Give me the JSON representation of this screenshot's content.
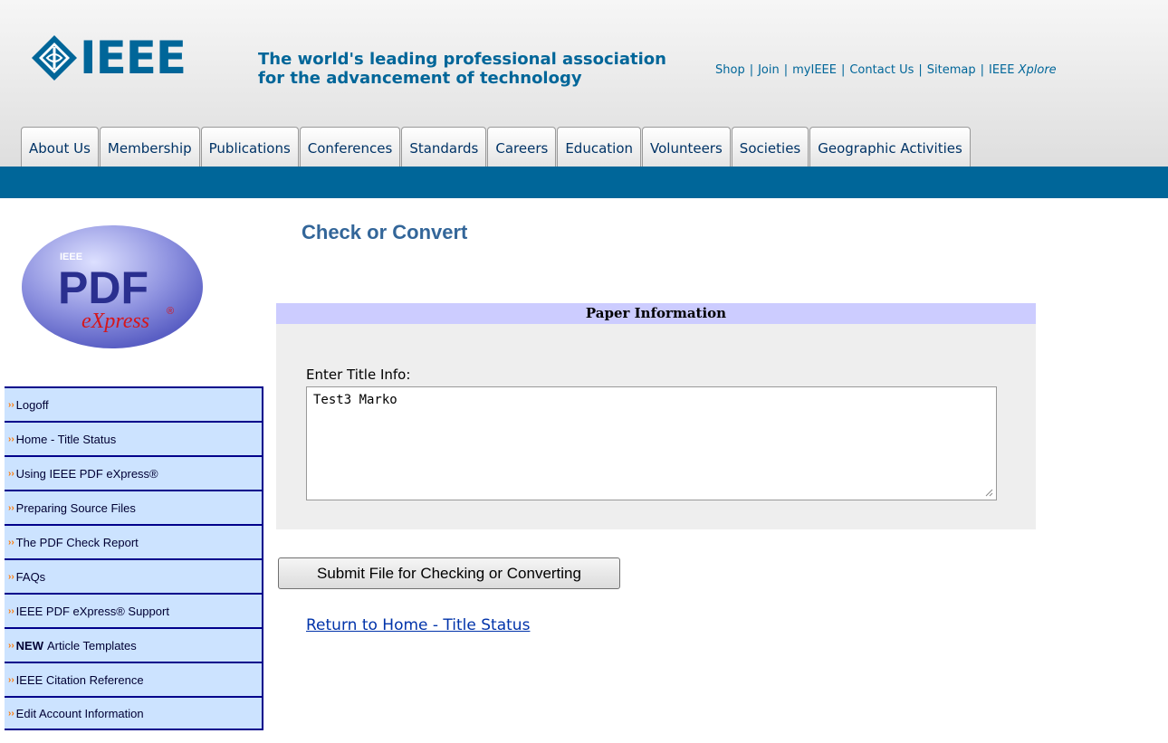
{
  "header": {
    "logo_text": "IEEE",
    "tagline_line1": "The world's leading professional association",
    "tagline_line2": "for the advancement of technology",
    "links": [
      "Shop",
      "Join",
      "myIEEE",
      "Contact Us",
      "Sitemap"
    ],
    "xplore_prefix": "IEEE",
    "xplore_suffix": "Xplore",
    "accent_color": "#006699"
  },
  "nav": {
    "tabs": [
      "About Us",
      "Membership",
      "Publications",
      "Conferences",
      "Standards",
      "Careers",
      "Education",
      "Volunteers",
      "Societies",
      "Geographic Activities"
    ]
  },
  "sidebar": {
    "logo": {
      "top_text": "IEEE",
      "main_text": "PDF",
      "sub_text": "eXpress",
      "registered": "®"
    },
    "items": [
      {
        "label": "Logoff"
      },
      {
        "label": "Home - Title Status"
      },
      {
        "label": "Using IEEE PDF eXpress®"
      },
      {
        "label": "Preparing Source Files"
      },
      {
        "label": "The PDF Check Report"
      },
      {
        "label": "FAQs"
      },
      {
        "label": "IEEE PDF eXpress® Support"
      },
      {
        "label": "Article Templates",
        "badge": "NEW"
      },
      {
        "label": "IEEE Citation Reference"
      },
      {
        "label": "Edit Account Information"
      }
    ]
  },
  "main": {
    "title": "Check or Convert",
    "panel": {
      "heading": "Paper Information",
      "field_label": "Enter Title Info:",
      "field_value": "Test3 Marko"
    },
    "submit_label": "Submit File for Checking or Converting",
    "return_link": "Return to Home - Title Status"
  }
}
